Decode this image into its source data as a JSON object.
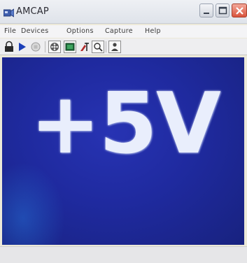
{
  "window": {
    "title": "AMCAP"
  },
  "menu": {
    "items": [
      "File",
      "Devices",
      "Options",
      "Capture",
      "Help"
    ]
  },
  "toolbar": {
    "icons": [
      "lock-icon",
      "play-icon",
      "stop-icon",
      "film-reel-icon",
      "preview-icon",
      "tools-icon",
      "zoom-icon",
      "user-icon"
    ]
  },
  "video": {
    "overlay_text": "+5V"
  },
  "status": {
    "text": ""
  },
  "colors": {
    "video_background": "#1f2a9f",
    "video_text": "#e9eefc",
    "close_button": "#d9533c"
  }
}
